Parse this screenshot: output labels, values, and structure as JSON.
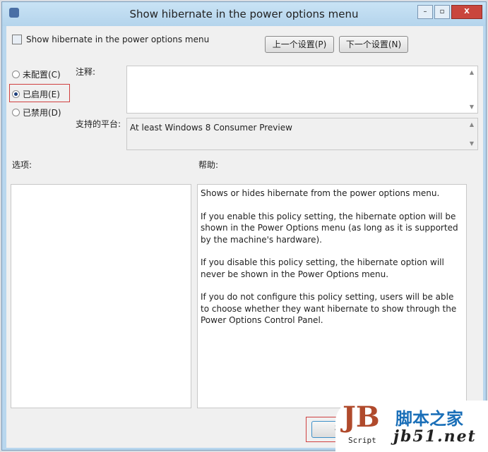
{
  "window": {
    "title": "Show hibernate in the power options menu",
    "close": "X"
  },
  "header": {
    "title": "Show hibernate in the power options menu"
  },
  "buttons": {
    "prev": "上一个设置(P)",
    "next": "下一个设置(N)",
    "ok": "确定"
  },
  "radios": [
    {
      "label": "未配置(C)",
      "checked": false
    },
    {
      "label": "已启用(E)",
      "checked": true
    },
    {
      "label": "已禁用(D)",
      "checked": false
    }
  ],
  "labels": {
    "comment": "注释:",
    "platform": "支持的平台:",
    "options": "选项:",
    "help": "帮助:"
  },
  "comment_value": "",
  "platform_value": "At least Windows 8 Consumer Preview",
  "help_text": [
    "Shows or hides hibernate from the power options menu.",
    "If you enable this policy setting, the hibernate option will be shown in the Power Options menu (as long as it is supported by the machine's hardware).",
    "If you disable this policy setting, the hibernate option will never be shown in the Power Options menu.",
    "If you do not configure this policy setting, users will be able to choose whether they want hibernate to show through the Power Options Control Panel."
  ],
  "watermark": {
    "logo": "JB",
    "script": "Script",
    "name": "脚本之家",
    "url": "jb51.net"
  }
}
